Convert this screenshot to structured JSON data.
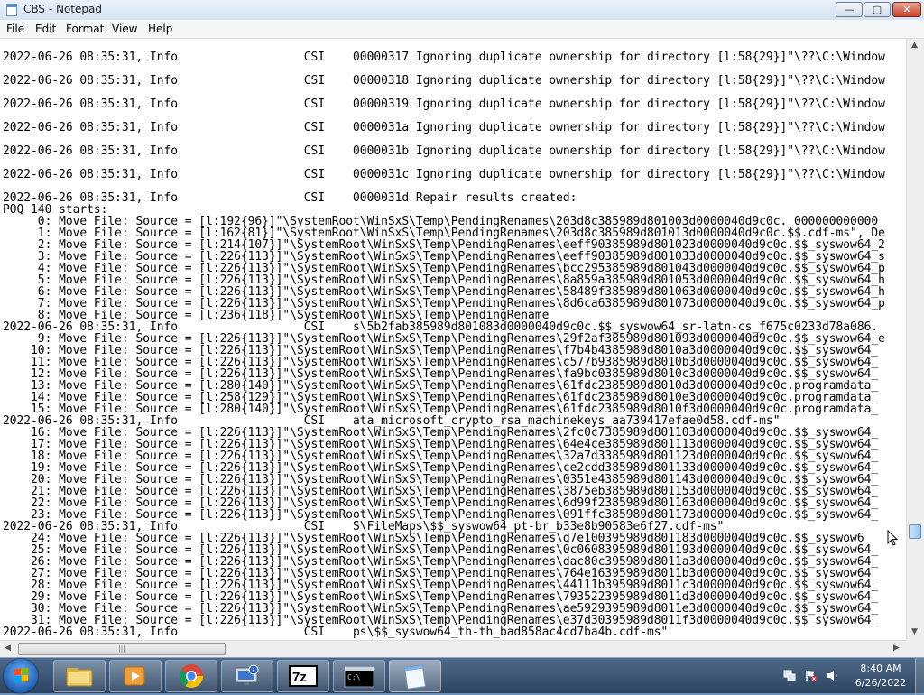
{
  "window": {
    "title": "CBS - Notepad",
    "controls": {
      "minimize": "—",
      "maximize": "▢",
      "close": "✕"
    }
  },
  "menu": [
    "File",
    "Edit",
    "Format",
    "View",
    "Help"
  ],
  "log_lines": [
    {
      "row": 0,
      "text": "2022-06-26 08:35:31, Info                  CSI    00000317 Ignoring duplicate ownership for directory [l:58{29}]\"\\??\\C:\\Window"
    },
    {
      "row": 2,
      "text": "2022-06-26 08:35:31, Info                  CSI    00000318 Ignoring duplicate ownership for directory [l:58{29}]\"\\??\\C:\\Window"
    },
    {
      "row": 4,
      "text": "2022-06-26 08:35:31, Info                  CSI    00000319 Ignoring duplicate ownership for directory [l:58{29}]\"\\??\\C:\\Window"
    },
    {
      "row": 6,
      "text": "2022-06-26 08:35:31, Info                  CSI    0000031a Ignoring duplicate ownership for directory [l:58{29}]\"\\??\\C:\\Window"
    },
    {
      "row": 8,
      "text": "2022-06-26 08:35:31, Info                  CSI    0000031b Ignoring duplicate ownership for directory [l:58{29}]\"\\??\\C:\\Window"
    },
    {
      "row": 10,
      "text": "2022-06-26 08:35:31, Info                  CSI    0000031c Ignoring duplicate ownership for directory [l:58{29}]\"\\??\\C:\\Window"
    },
    {
      "row": 12,
      "text": "2022-06-26 08:35:31, Info                  CSI    0000031d Repair results created:"
    },
    {
      "row": 13,
      "text": "POQ 140 starts:"
    },
    {
      "row": 14,
      "text": "     0: Move File: Source = [l:192{96}]\"\\SystemRoot\\WinSxS\\Temp\\PendingRenames\\203d8c385989d801003d0000040d9c0c._000000000000"
    },
    {
      "row": 15,
      "text": "     1: Move File: Source = [l:162{81}]\"\\SystemRoot\\WinSxS\\Temp\\PendingRenames\\203d8c385989d801013d0000040d9c0c.$$.cdf-ms\", De"
    },
    {
      "row": 16,
      "text": "     2: Move File: Source = [l:214{107}]\"\\SystemRoot\\WinSxS\\Temp\\PendingRenames\\eeff90385989d801023d0000040d9c0c.$$_syswow64_2"
    },
    {
      "row": 17,
      "text": "     3: Move File: Source = [l:226{113}]\"\\SystemRoot\\WinSxS\\Temp\\PendingRenames\\eeff90385989d801033d0000040d9c0c.$$_syswow64_s"
    },
    {
      "row": 18,
      "text": "     4: Move File: Source = [l:226{113}]\"\\SystemRoot\\WinSxS\\Temp\\PendingRenames\\bcc295385989d801043d0000040d9c0c.$$_syswow64_p"
    },
    {
      "row": 19,
      "text": "     5: Move File: Source = [l:226{113}]\"\\SystemRoot\\WinSxS\\Temp\\PendingRenames\\8a859a385989d801053d0000040d9c0c.$$_syswow64_h"
    },
    {
      "row": 20,
      "text": "     6: Move File: Source = [l:226{113}]\"\\SystemRoot\\WinSxS\\Temp\\PendingRenames\\58489f385989d801063d0000040d9c0c.$$_syswow64_h"
    },
    {
      "row": 21,
      "text": "     7: Move File: Source = [l:226{113}]\"\\SystemRoot\\WinSxS\\Temp\\PendingRenames\\8d6ca6385989d801073d0000040d9c0c.$$_syswow64_p"
    },
    {
      "row": 22,
      "text": "     8: Move File: Source = [l:236{118}]\"\\SystemRoot\\WinSxS\\Temp\\PendingRename"
    },
    {
      "row": 23,
      "text": "2022-06-26 08:35:31, Info                  CSI    s\\5b2fab385989d801083d0000040d9c0c.$$_syswow64_sr-latn-cs_f675c0233d78a086."
    },
    {
      "row": 24,
      "text": "     9: Move File: Source = [l:226{113}]\"\\SystemRoot\\WinSxS\\Temp\\PendingRenames\\29f2af385989d801093d0000040d9c0c.$$_syswow64_e"
    },
    {
      "row": 25,
      "text": "    10: Move File: Source = [l:226{113}]\"\\SystemRoot\\WinSxS\\Temp\\PendingRenames\\f7b4b4385989d8010a3d0000040d9c0c.$$_syswow64_"
    },
    {
      "row": 26,
      "text": "    11: Move File: Source = [l:226{113}]\"\\SystemRoot\\WinSxS\\Temp\\PendingRenames\\c577b9385989d8010b3d0000040d9c0c.$$_syswow64_"
    },
    {
      "row": 27,
      "text": "    12: Move File: Source = [l:226{113}]\"\\SystemRoot\\WinSxS\\Temp\\PendingRenames\\fa9bc0385989d8010c3d0000040d9c0c.$$_syswow64_"
    },
    {
      "row": 28,
      "text": "    13: Move File: Source = [l:280{140}]\"\\SystemRoot\\WinSxS\\Temp\\PendingRenames\\61fdc2385989d8010d3d0000040d9c0c.programdata_"
    },
    {
      "row": 29,
      "text": "    14: Move File: Source = [l:258{129}]\"\\SystemRoot\\WinSxS\\Temp\\PendingRenames\\61fdc2385989d8010e3d0000040d9c0c.programdata_"
    },
    {
      "row": 30,
      "text": "    15: Move File: Source = [l:280{140}]\"\\SystemRoot\\WinSxS\\Temp\\PendingRenames\\61fdc2385989d8010f3d0000040d9c0c.programdata_"
    },
    {
      "row": 31,
      "text": "2022-06-26 08:35:31, Info                  CSI    ata_microsoft_crypto_rsa_machinekeys_aa739417efae0d58.cdf-ms\""
    },
    {
      "row": 32,
      "text": "    16: Move File: Source = [l:226{113}]\"\\SystemRoot\\WinSxS\\Temp\\PendingRenames\\2fc0c7385989d801103d0000040d9c0c.$$_syswow64_"
    },
    {
      "row": 33,
      "text": "    17: Move File: Source = [l:226{113}]\"\\SystemRoot\\WinSxS\\Temp\\PendingRenames\\64e4ce385989d801113d0000040d9c0c.$$_syswow64_"
    },
    {
      "row": 34,
      "text": "    18: Move File: Source = [l:226{113}]\"\\SystemRoot\\WinSxS\\Temp\\PendingRenames\\32a7d3385989d801123d0000040d9c0c.$$_syswow64_"
    },
    {
      "row": 35,
      "text": "    19: Move File: Source = [l:226{113}]\"\\SystemRoot\\WinSxS\\Temp\\PendingRenames\\ce2cdd385989d801133d0000040d9c0c.$$_syswow64_"
    },
    {
      "row": 36,
      "text": "    20: Move File: Source = [l:226{113}]\"\\SystemRoot\\WinSxS\\Temp\\PendingRenames\\0351e4385989d801143d0000040d9c0c.$$_syswow64_"
    },
    {
      "row": 37,
      "text": "    21: Move File: Source = [l:226{113}]\"\\SystemRoot\\WinSxS\\Temp\\PendingRenames\\3875eb385989d801153d0000040d9c0c.$$_syswow64_"
    },
    {
      "row": 38,
      "text": "    22: Move File: Source = [l:226{113}]\"\\SystemRoot\\WinSxS\\Temp\\PendingRenames\\6d99f2385989d801163d0000040d9c0c.$$_syswow64_"
    },
    {
      "row": 39,
      "text": "    23: Move File: Source = [l:226{113}]\"\\SystemRoot\\WinSxS\\Temp\\PendingRenames\\091ffc385989d801173d0000040d9c0c.$$_syswow64_"
    },
    {
      "row": 40,
      "text": "2022-06-26 08:35:31, Info                  CSI    S\\FileMaps\\$$_syswow64_pt-br_b33e8b90583e6f27.cdf-ms\""
    },
    {
      "row": 41,
      "text": "    24: Move File: Source = [l:226{113}]\"\\SystemRoot\\WinSxS\\Temp\\PendingRenames\\d7e100395989d801183d0000040d9c0c.$$_syswow6"
    },
    {
      "row": 42,
      "text": "    25: Move File: Source = [l:226{113}]\"\\SystemRoot\\WinSxS\\Temp\\PendingRenames\\0c0608395989d801193d0000040d9c0c.$$_syswow64_"
    },
    {
      "row": 43,
      "text": "    26: Move File: Source = [l:226{113}]\"\\SystemRoot\\WinSxS\\Temp\\PendingRenames\\dac80c395989d8011a3d0000040d9c0c.$$_syswow64_"
    },
    {
      "row": 44,
      "text": "    27: Move File: Source = [l:226{113}]\"\\SystemRoot\\WinSxS\\Temp\\PendingRenames\\764e16395989d8011b3d0000040d9c0c.$$_syswow64_"
    },
    {
      "row": 45,
      "text": "    28: Move File: Source = [l:226{113}]\"\\SystemRoot\\WinSxS\\Temp\\PendingRenames\\44111b395989d8011c3d0000040d9c0c.$$_syswow64_"
    },
    {
      "row": 46,
      "text": "    29: Move File: Source = [l:226{113}]\"\\SystemRoot\\WinSxS\\Temp\\PendingRenames\\793522395989d8011d3d0000040d9c0c.$$_syswow64_"
    },
    {
      "row": 47,
      "text": "    30: Move File: Source = [l:226{113}]\"\\SystemRoot\\WinSxS\\Temp\\PendingRenames\\ae5929395989d8011e3d0000040d9c0c.$$_syswow64_"
    },
    {
      "row": 48,
      "text": "    31: Move File: Source = [l:226{113}]\"\\SystemRoot\\WinSxS\\Temp\\PendingRenames\\e37d30395989d8011f3d0000040d9c0c.$$_syswow64_"
    },
    {
      "row": 49,
      "text": "2022-06-26 08:35:31, Info                  CSI    ps\\$$_syswow64_th-th_bad858ac4cd7ba4b.cdf-ms\""
    }
  ],
  "taskbar": {
    "items": [
      {
        "name": "windows-explorer",
        "icon": "folder-icon",
        "active": false
      },
      {
        "name": "media-player",
        "icon": "media-player-icon",
        "active": false
      },
      {
        "name": "chrome",
        "icon": "chrome-icon",
        "active": false
      },
      {
        "name": "system-info",
        "icon": "computer-info-icon",
        "active": false
      },
      {
        "name": "7zip",
        "icon": "seven-zip-icon",
        "label": "7z",
        "active": false
      },
      {
        "name": "command-prompt",
        "icon": "cmd-icon",
        "label": "C:\\_",
        "active": false
      },
      {
        "name": "notepad",
        "icon": "notepad-icon",
        "active": true
      }
    ]
  },
  "tray": {
    "time": "8:40 AM",
    "date": "6/26/2022",
    "icons": [
      "network-icon",
      "action-center-flag-icon",
      "volume-icon"
    ]
  },
  "colors": {
    "taskbar": "#3b5878",
    "close_button": "#c6442b",
    "scroll_thumb": "#9dc3ea"
  }
}
